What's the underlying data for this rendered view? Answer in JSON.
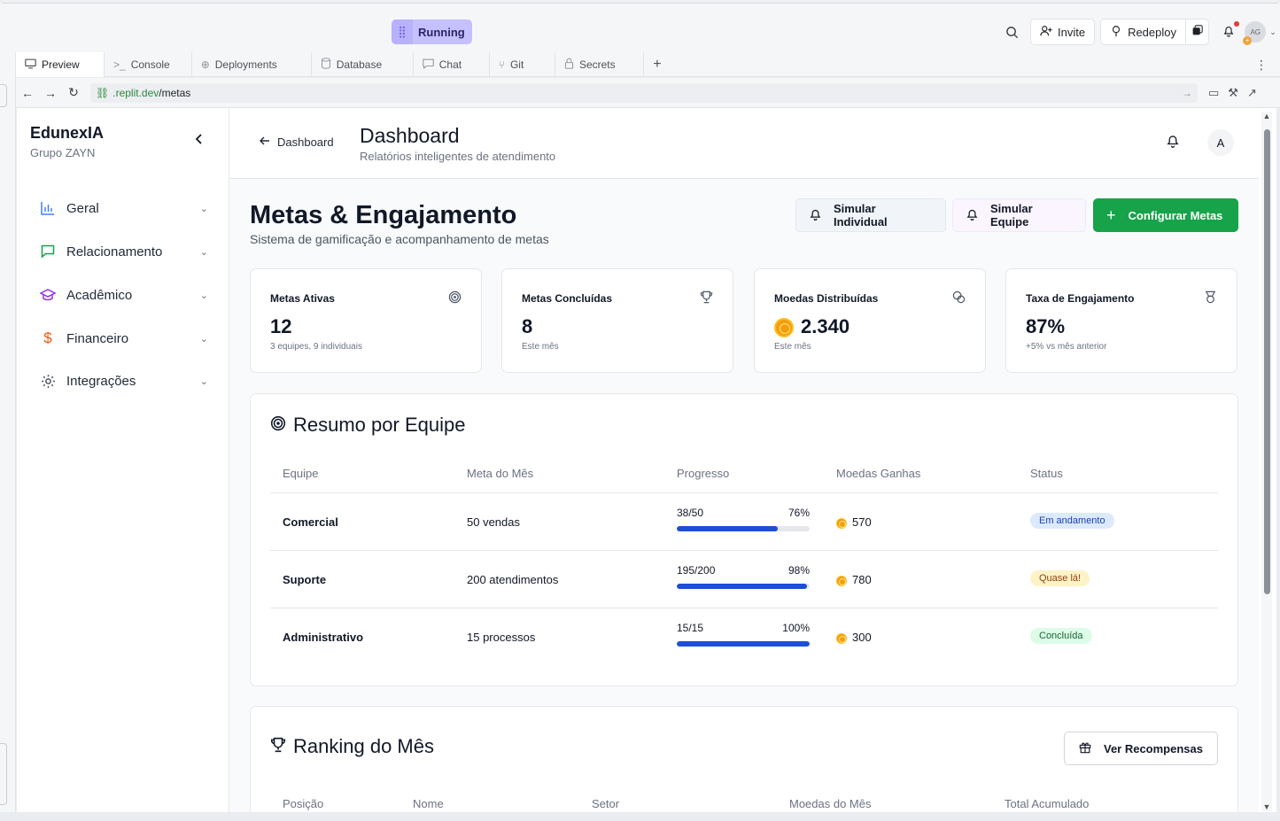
{
  "replit": {
    "status_label": "Running",
    "invite_label": "Invite",
    "redeploy_label": "Redeploy",
    "avatar_initials": "AG",
    "tabs": [
      {
        "label": "Preview",
        "icon": "monitor-icon"
      },
      {
        "label": "Console",
        "icon": "terminal-icon"
      },
      {
        "label": "Deployments",
        "icon": "deploy-icon"
      },
      {
        "label": "Database",
        "icon": "database-icon"
      },
      {
        "label": "Chat",
        "icon": "chat-icon"
      },
      {
        "label": "Git",
        "icon": "git-icon"
      },
      {
        "label": "Secrets",
        "icon": "lock-icon"
      }
    ],
    "url_host": ".replit.dev",
    "url_path": "/metas"
  },
  "sidebar": {
    "brand": "EdunexIA",
    "subtitle": "Grupo ZAYN",
    "items": [
      {
        "label": "Geral",
        "icon": "bar-chart-icon",
        "color": "#3b82f6"
      },
      {
        "label": "Relacionamento",
        "icon": "message-square-icon",
        "color": "#16a34a"
      },
      {
        "label": "Acadêmico",
        "icon": "graduation-cap-icon",
        "color": "#9333ea"
      },
      {
        "label": "Financeiro",
        "icon": "dollar-icon",
        "color": "#ea580c"
      },
      {
        "label": "Integrações",
        "icon": "gear-icon",
        "color": "#4b5563"
      }
    ]
  },
  "header": {
    "back_label": "Dashboard",
    "title": "Dashboard",
    "subtitle": "Relatórios inteligentes de atendimento",
    "avatar": "A"
  },
  "page": {
    "title": "Metas & Engajamento",
    "subtitle": "Sistema de gamificação e acompanhamento de metas",
    "btn_individual": "Simular Individual",
    "btn_team": "Simular Equipe",
    "btn_config": "Configurar Metas"
  },
  "stats": [
    {
      "title": "Metas Ativas",
      "value": "12",
      "sub": "3 equipes, 9 individuais",
      "icon": "target-icon"
    },
    {
      "title": "Metas Concluídas",
      "value": "8",
      "sub": "Este mês",
      "icon": "trophy-icon"
    },
    {
      "title": "Moedas Distribuídas",
      "value": "2.340",
      "sub": "Este mês",
      "icon": "coins-icon"
    },
    {
      "title": "Taxa de Engajamento",
      "value": "87%",
      "sub": "+5% vs mês anterior",
      "icon": "medal-icon"
    }
  ],
  "team_summary": {
    "title": "Resumo por Equipe",
    "headers": [
      "Equipe",
      "Meta do Mês",
      "Progresso",
      "Moedas Ganhas",
      "Status"
    ],
    "rows": [
      {
        "team": "Comercial",
        "goal": "50 vendas",
        "progress_text": "38/50",
        "percent": "76%",
        "percent_value": 76,
        "coins": "570",
        "status": "Em andamento",
        "status_bg": "#dbeafe",
        "status_fg": "#1e40af"
      },
      {
        "team": "Suporte",
        "goal": "200 atendimentos",
        "progress_text": "195/200",
        "percent": "98%",
        "percent_value": 98,
        "coins": "780",
        "status": "Quase lá!",
        "status_bg": "#fef3c7",
        "status_fg": "#92400e"
      },
      {
        "team": "Administrativo",
        "goal": "15 processos",
        "progress_text": "15/15",
        "percent": "100%",
        "percent_value": 100,
        "coins": "300",
        "status": "Concluída",
        "status_bg": "#dcfce7",
        "status_fg": "#166534"
      }
    ]
  },
  "ranking": {
    "title": "Ranking do Mês",
    "button": "Ver Recompensas",
    "headers": [
      "Posição",
      "Nome",
      "Setor",
      "Moedas do Mês",
      "Total Acumulado"
    ]
  },
  "colors": {
    "accent_green": "#16a34a",
    "progress_blue": "#1d4ed8",
    "running_purple": "#c5c0ff"
  }
}
